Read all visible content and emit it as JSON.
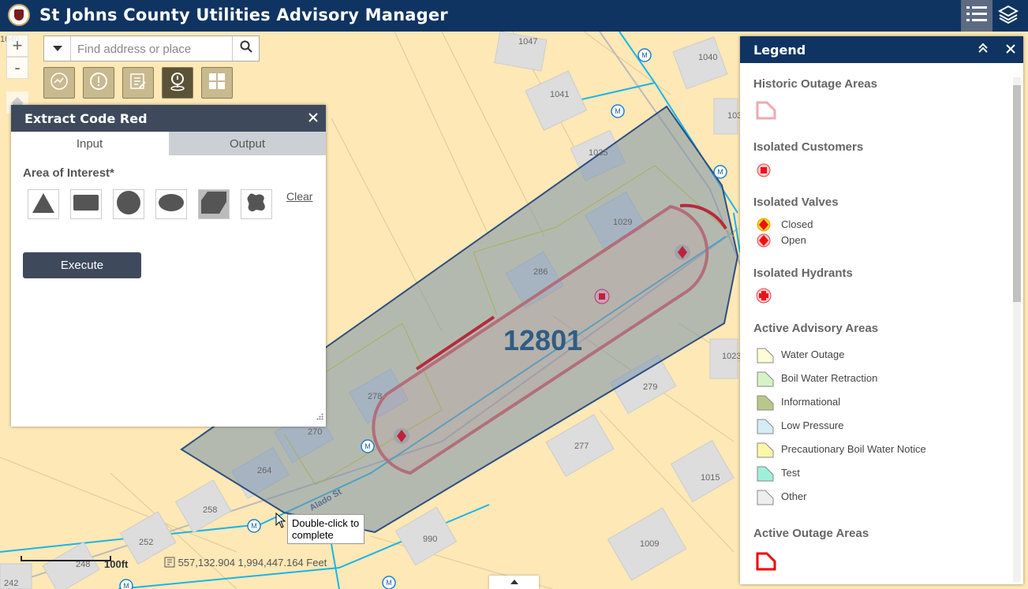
{
  "app": {
    "title": "St Johns County Utilities Advisory Manager"
  },
  "search": {
    "placeholder": "Find address or place"
  },
  "zoom": {
    "in": "+",
    "out": "-"
  },
  "panel": {
    "title": "Extract Code Red",
    "tabs": [
      "Input",
      "Output"
    ],
    "area_label": "Area of Interest*",
    "clear_label": "Clear",
    "execute_label": "Execute"
  },
  "legend": {
    "title": "Legend",
    "sections": [
      {
        "title": "Historic Outage Areas"
      },
      {
        "title": "Isolated Customers"
      },
      {
        "title": "Isolated Valves",
        "items": [
          "Closed",
          "Open"
        ]
      },
      {
        "title": "Isolated Hydrants"
      },
      {
        "title": "Active Advisory Areas",
        "items": [
          "Water Outage",
          "Boil Water Retraction",
          "Informational",
          "Low Pressure",
          "Precautionary Boil Water Notice",
          "Test",
          "Other"
        ]
      },
      {
        "title": "Active Outage Areas"
      }
    ]
  },
  "advisory_colors": [
    "#fffbd6",
    "#d6f3c6",
    "#b9c88a",
    "#d4ecf5",
    "#fbf7a8",
    "#9ef0d8",
    "#eeeeee"
  ],
  "map": {
    "area_label": "12801",
    "parcels": [
      "1047",
      "1040",
      "1041",
      "103",
      "1035",
      "1029",
      "286",
      "1023",
      "279",
      "278",
      "270",
      "277",
      "1015",
      "264",
      "258",
      "252",
      "990",
      "1009",
      "248",
      "242",
      "1040"
    ],
    "street": "Alado St",
    "tooltip": "Double-click to complete",
    "scale_label": "100ft",
    "coordinates": "557,132.904  1,994,447.164 Feet"
  }
}
